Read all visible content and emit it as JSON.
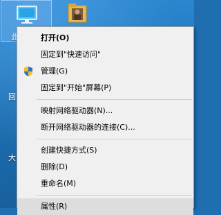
{
  "desktop": {
    "pc_label": "此",
    "edge_texts": [
      "回",
      "大"
    ]
  },
  "context_menu": {
    "items": [
      {
        "label": "打开(O)",
        "bold": true
      },
      {
        "label": "固定到\"快速访问\""
      },
      {
        "label": "管理(G)",
        "icon": "shield-icon"
      },
      {
        "label": "固定到\"开始\"屏幕(P)"
      },
      {
        "label": "映射网络驱动器(N)..."
      },
      {
        "label": "断开网络驱动器的连接(C)..."
      },
      {
        "label": "创建快捷方式(S)"
      },
      {
        "label": "删除(D)"
      },
      {
        "label": "重命名(M)"
      },
      {
        "label": "属性(R)",
        "highlighted": true
      }
    ]
  },
  "colors": {
    "desktop_blue": "#1f6fb0",
    "menu_background": "#f0f0f0",
    "highlight": "#dddddd"
  }
}
